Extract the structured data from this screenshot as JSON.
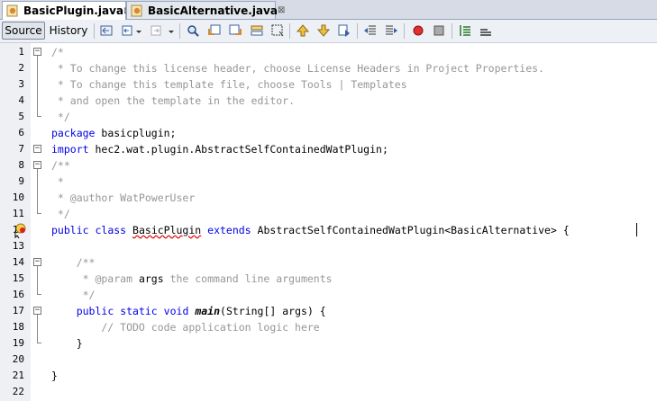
{
  "tabs": [
    {
      "label": "BasicPlugin.java",
      "active": true,
      "close": "⊠"
    },
    {
      "label": "BasicAlternative.java",
      "active": false,
      "close": "⊠"
    }
  ],
  "toolbar": {
    "source_label": "Source",
    "history_label": "History"
  },
  "editor": {
    "line_numbers": [
      "1",
      "2",
      "3",
      "4",
      "5",
      "6",
      "7",
      "8",
      "9",
      "10",
      "11",
      "12",
      "13",
      "14",
      "15",
      "16",
      "17",
      "18",
      "19",
      "20",
      "21",
      "22"
    ],
    "lines": [
      {
        "parts": [
          {
            "t": "/*",
            "c": "cmt"
          }
        ]
      },
      {
        "parts": [
          {
            "t": " * To change this license header, choose License Headers in Project Properties.",
            "c": "cmt"
          }
        ]
      },
      {
        "parts": [
          {
            "t": " * To change this template file, choose Tools | Templates",
            "c": "cmt"
          }
        ]
      },
      {
        "parts": [
          {
            "t": " * and open the template in the editor.",
            "c": "cmt"
          }
        ]
      },
      {
        "parts": [
          {
            "t": " */",
            "c": "cmt"
          }
        ]
      },
      {
        "parts": [
          {
            "t": "package",
            "c": "kw"
          },
          {
            "t": " basicplugin;",
            "c": ""
          }
        ]
      },
      {
        "parts": [
          {
            "t": "import",
            "c": "kw"
          },
          {
            "t": " hec2.wat.plugin.AbstractSelfContainedWatPlugin;",
            "c": ""
          }
        ]
      },
      {
        "parts": [
          {
            "t": "/**",
            "c": "cmt"
          }
        ]
      },
      {
        "parts": [
          {
            "t": " *",
            "c": "cmt"
          }
        ]
      },
      {
        "parts": [
          {
            "t": " * @author WatPowerUser",
            "c": "cmt"
          }
        ]
      },
      {
        "parts": [
          {
            "t": " */",
            "c": "cmt"
          }
        ]
      },
      {
        "parts": [
          {
            "t": "public",
            "c": "kw"
          },
          {
            "t": " ",
            "c": ""
          },
          {
            "t": "class",
            "c": "kw"
          },
          {
            "t": " ",
            "c": ""
          },
          {
            "t": "BasicPlugin",
            "c": "squig"
          },
          {
            "t": " ",
            "c": ""
          },
          {
            "t": "extends",
            "c": "kw"
          },
          {
            "t": " AbstractSelfContainedWatPlugin<BasicAlternative> {",
            "c": ""
          }
        ]
      },
      {
        "parts": [
          {
            "t": "",
            "c": ""
          }
        ]
      },
      {
        "parts": [
          {
            "t": "    /**",
            "c": "cmt"
          }
        ]
      },
      {
        "parts": [
          {
            "t": "     * @param ",
            "c": "cmt"
          },
          {
            "t": "args",
            "c": ""
          },
          {
            "t": " the command line arguments",
            "c": "cmt"
          }
        ]
      },
      {
        "parts": [
          {
            "t": "     */",
            "c": "cmt"
          }
        ]
      },
      {
        "parts": [
          {
            "t": "    ",
            "c": ""
          },
          {
            "t": "public",
            "c": "kw"
          },
          {
            "t": " ",
            "c": ""
          },
          {
            "t": "static",
            "c": "kw"
          },
          {
            "t": " ",
            "c": ""
          },
          {
            "t": "void",
            "c": "kw"
          },
          {
            "t": " ",
            "c": ""
          },
          {
            "t": "main",
            "c": "it"
          },
          {
            "t": "(String[] args) {",
            "c": ""
          }
        ]
      },
      {
        "parts": [
          {
            "t": "        // TODO code application logic here",
            "c": "cmt"
          }
        ]
      },
      {
        "parts": [
          {
            "t": "    }",
            "c": ""
          }
        ]
      },
      {
        "parts": [
          {
            "t": "",
            "c": ""
          }
        ]
      },
      {
        "parts": [
          {
            "t": "}",
            "c": ""
          }
        ]
      },
      {
        "parts": [
          {
            "t": "",
            "c": ""
          }
        ]
      }
    ]
  },
  "icons": {
    "tab_file_icon": "java-file-icon",
    "error_marker": "error-bulb-icon",
    "toolbar_icons": [
      "last-edit-icon",
      "back-icon",
      "forward-icon",
      "find-icon",
      "find-previous-icon",
      "find-next-icon",
      "toggle-highlight-icon",
      "toggle-rectangular-selection-icon",
      "previous-bookmark-icon",
      "next-bookmark-icon",
      "toggle-bookmark-icon",
      "shift-left-icon",
      "shift-right-icon",
      "start-macro-icon",
      "stop-macro-icon",
      "comment-icon",
      "uncomment-icon"
    ]
  },
  "colors": {
    "keyword": "#0000e6",
    "comment": "#969696",
    "error": "#e00000"
  }
}
